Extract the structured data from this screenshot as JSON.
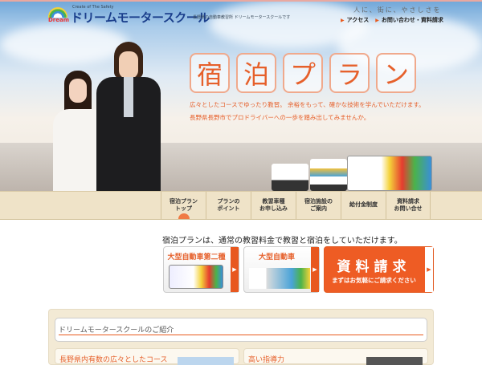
{
  "header": {
    "logo_badge": "Dream",
    "logo_tagline": "Create of The Safety",
    "logo_text": "ドリームモータースクール",
    "subtitle": "長野県の自動車教習所 ドリームモータースクールです",
    "motto": "人に、街に、やさしさを",
    "links": [
      "アクセス",
      "お問い合わせ・資料請求"
    ]
  },
  "hero": {
    "title_chars": [
      "宿",
      "泊",
      "プ",
      "ラ",
      "ン"
    ],
    "lead_lines": [
      "広々としたコースでゆったり教習。 余裕をもって、確かな技術を学んでいただけます。",
      "長野県長野市でプロドライバーへの一歩を踏み出してみませんか。"
    ]
  },
  "nav": [
    {
      "label": "宿泊プラン\nトップ",
      "active": true
    },
    {
      "label": "プランの\nポイント"
    },
    {
      "label": "教習車種\nお申し込み"
    },
    {
      "label": "宿泊施設の\nご案内"
    },
    {
      "label": "給付金制度"
    },
    {
      "label": "資料請求\nお問い合せ"
    }
  ],
  "intro": "宿泊プランは、通常の教習料金で教習と宿泊をしていただけます。",
  "cards": [
    {
      "label": "大型自動車第二種"
    },
    {
      "label": "大型自動車"
    }
  ],
  "request": {
    "title": "資料請求",
    "subtitle": "まずはお気軽にご請求ください"
  },
  "section": {
    "title": "ドリームモータースクールのご紹介",
    "items": [
      "長野県内有数の広々としたコース",
      "高い指導力"
    ]
  },
  "colors": {
    "accent": "#e6602b",
    "nav_bg": "#efe3c8"
  }
}
